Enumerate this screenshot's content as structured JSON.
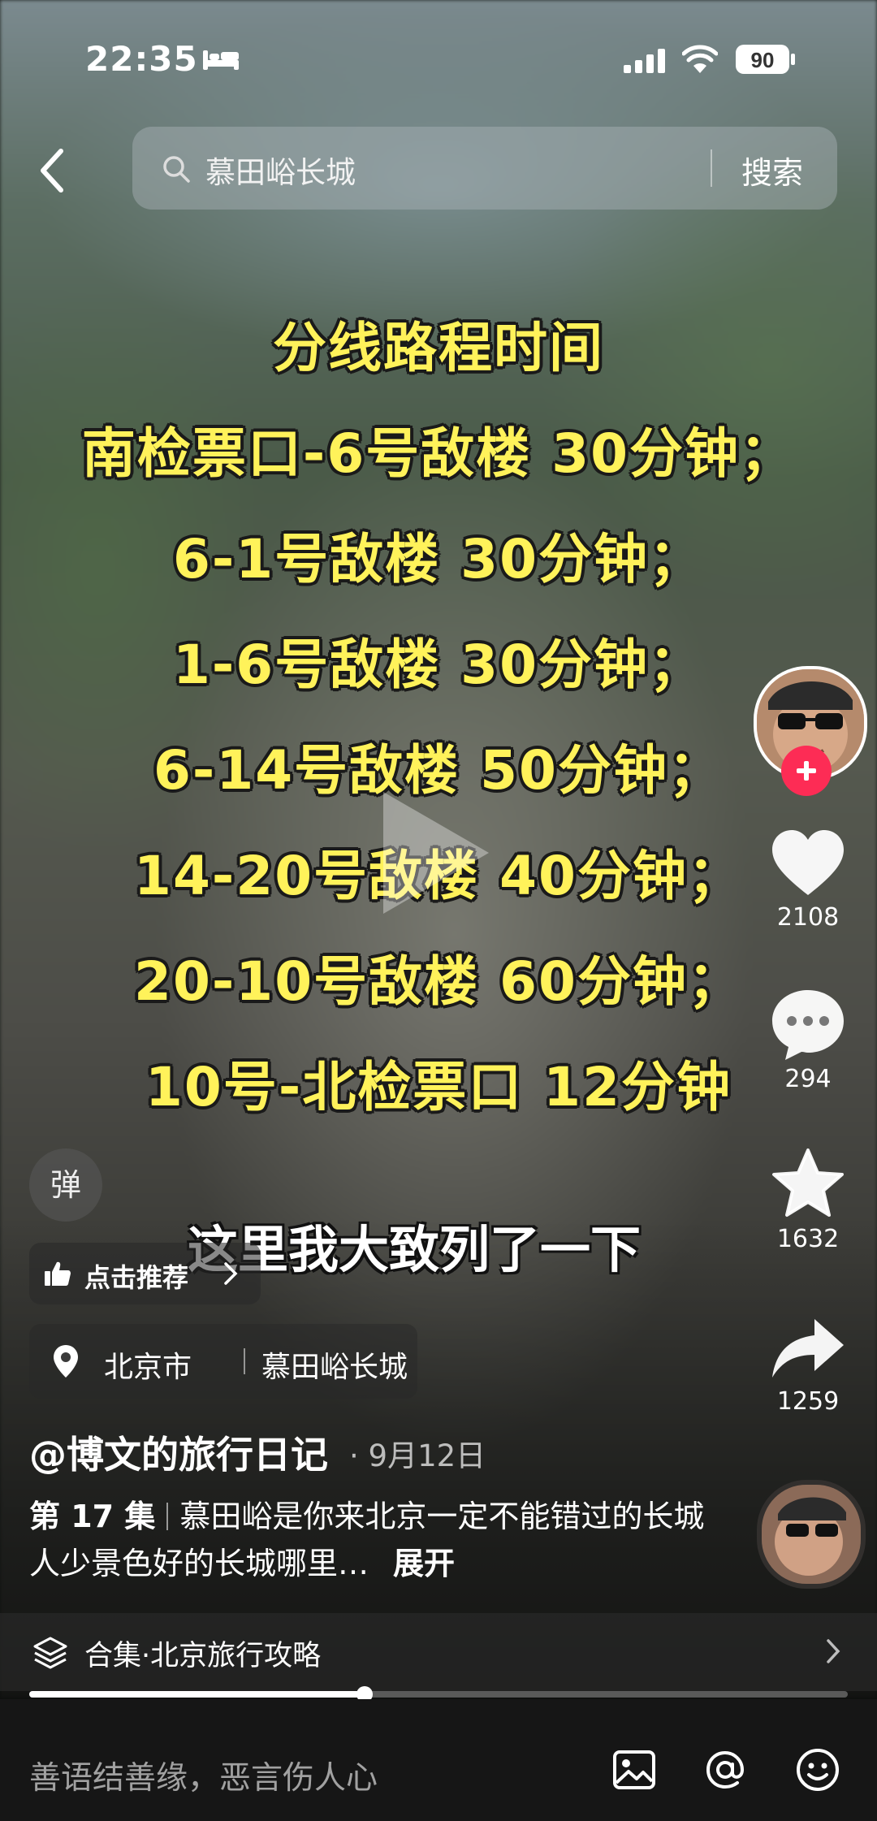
{
  "status_bar": {
    "time": "22:35",
    "battery": "90"
  },
  "search": {
    "query": "慕田峪长城",
    "button": "搜索"
  },
  "caption": {
    "title": "分线路程时间",
    "lines": [
      "南检票口-6号敌楼 30分钟；",
      "6-1号敌楼 30分钟；",
      "1-6号敌楼 30分钟；",
      "6-14号敌楼 50分钟；",
      "14-20号敌楼 40分钟；",
      "20-10号敌楼 60分钟；",
      "10号-北检票口 12分钟"
    ]
  },
  "subtitle": "这里我大致列了一下",
  "danmu_label": "弹",
  "recommend": "点击推荐",
  "location": {
    "city": "北京市",
    "place": "慕田峪长城"
  },
  "author": {
    "name": "@博文的旅行日记",
    "date": "· 9月12日"
  },
  "description": {
    "episode": "第 17 集",
    "text": "慕田峪是你来北京一定不能错过的长城 人少景色好的长城哪里…",
    "more": "展开"
  },
  "actions": {
    "likes": "2108",
    "comments": "294",
    "favorites": "1632",
    "shares": "1259"
  },
  "collection": "合集·北京旅行攻略",
  "progress": 0.41,
  "comment_placeholder": "善语结善缘，恶言伤人心",
  "colors": {
    "caption": "#fff25a",
    "follow": "#fd2c55"
  }
}
